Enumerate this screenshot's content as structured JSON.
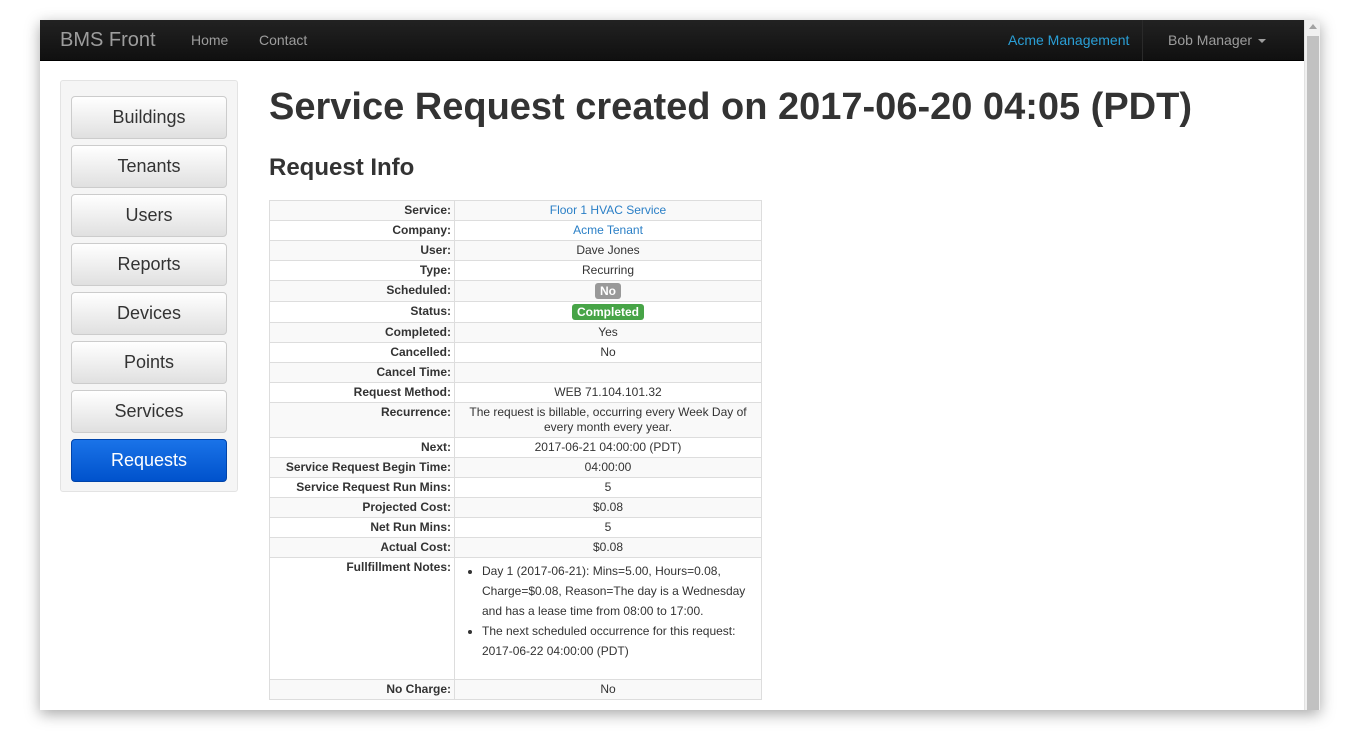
{
  "navbar": {
    "brand": "BMS Front",
    "links": [
      "Home",
      "Contact"
    ],
    "org": "Acme Management",
    "user": "Bob Manager"
  },
  "sidebar": {
    "items": [
      {
        "label": "Buildings",
        "active": false
      },
      {
        "label": "Tenants",
        "active": false
      },
      {
        "label": "Users",
        "active": false
      },
      {
        "label": "Reports",
        "active": false
      },
      {
        "label": "Devices",
        "active": false
      },
      {
        "label": "Points",
        "active": false
      },
      {
        "label": "Services",
        "active": false
      },
      {
        "label": "Requests",
        "active": true
      }
    ]
  },
  "page": {
    "title": "Service Request created on 2017-06-20 04:05 (PDT)",
    "section": "Request Info"
  },
  "info": {
    "service_label": "Service:",
    "service": "Floor 1 HVAC Service",
    "company_label": "Company:",
    "company": "Acme Tenant",
    "user_label": "User:",
    "user": "Dave Jones",
    "type_label": "Type:",
    "type": "Recurring",
    "scheduled_label": "Scheduled:",
    "scheduled": "No",
    "status_label": "Status:",
    "status": "Completed",
    "completed_label": "Completed:",
    "completed": "Yes",
    "cancelled_label": "Cancelled:",
    "cancelled": "No",
    "cancel_time_label": "Cancel Time:",
    "cancel_time": "",
    "request_method_label": "Request Method:",
    "request_method": "WEB 71.104.101.32",
    "recurrence_label": "Recurrence:",
    "recurrence": "The request is billable, occurring every Week Day of every month every year.",
    "next_label": "Next:",
    "next": "2017-06-21 04:00:00 (PDT)",
    "begin_time_label": "Service Request Begin Time:",
    "begin_time": "04:00:00",
    "run_mins_label": "Service Request Run Mins:",
    "run_mins": "5",
    "projected_cost_label": "Projected Cost:",
    "projected_cost": "$0.08",
    "net_run_mins_label": "Net Run Mins:",
    "net_run_mins": "5",
    "actual_cost_label": "Actual Cost:",
    "actual_cost": "$0.08",
    "notes_label": "Fullfillment Notes:",
    "notes": [
      "Day 1 (2017-06-21): Mins=5.00, Hours=0.08, Charge=$0.08, Reason=The day is a Wednesday and has a lease time from 08:00 to 17:00.",
      "The next scheduled occurrence for this request: 2017-06-22 04:00:00 (PDT)"
    ],
    "no_charge_label": "No Charge:",
    "no_charge": "No"
  },
  "colors": {
    "navbar": "#151515",
    "link": "#2a7fc6",
    "active_button": "#0a63d8",
    "label_default": "#999999",
    "label_success": "#47a447"
  }
}
